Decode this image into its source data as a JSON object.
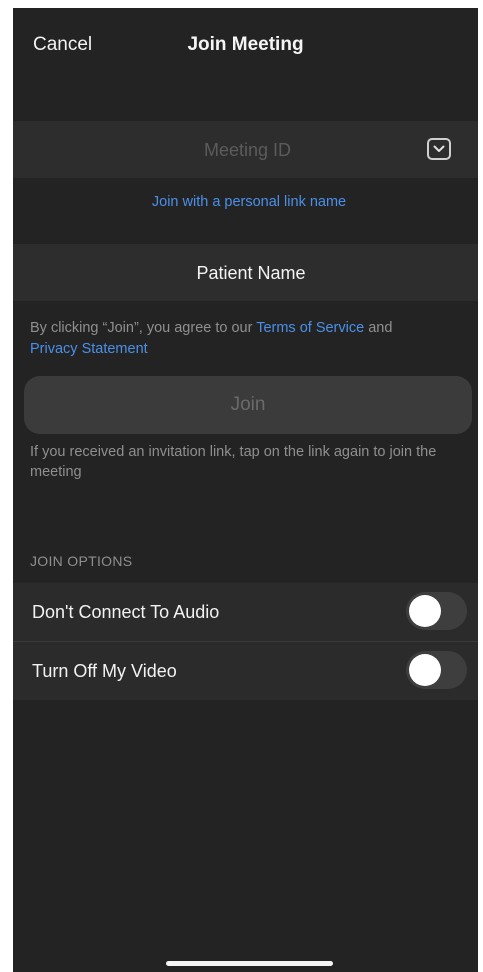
{
  "header": {
    "cancel_label": "Cancel",
    "title": "Join Meeting"
  },
  "meeting_id": {
    "placeholder": "Meeting ID",
    "value": "",
    "dropdown_icon": "chevron-down-icon"
  },
  "personal_link_label": "Join with a personal link name",
  "name_field": {
    "value": "Patient Name"
  },
  "agreement": {
    "prefix": "By clicking “Join”, you agree to our ",
    "terms_link": "Terms of Service",
    "middle": " and",
    "privacy_link": "Privacy Statement"
  },
  "join_button_label": "Join",
  "invite_hint": "If you received an invitation link, tap on the link again to join the meeting",
  "join_options": {
    "heading": "JOIN OPTIONS",
    "items": [
      {
        "label": "Don't Connect To Audio",
        "enabled": false
      },
      {
        "label": "Turn Off My Video",
        "enabled": false
      }
    ]
  },
  "colors": {
    "background": "#232323",
    "field_background": "#2d2d2d",
    "link_blue": "#4a90e9",
    "muted_text": "#8f8f8f",
    "toggle_off_track": "#3e3e3e"
  }
}
